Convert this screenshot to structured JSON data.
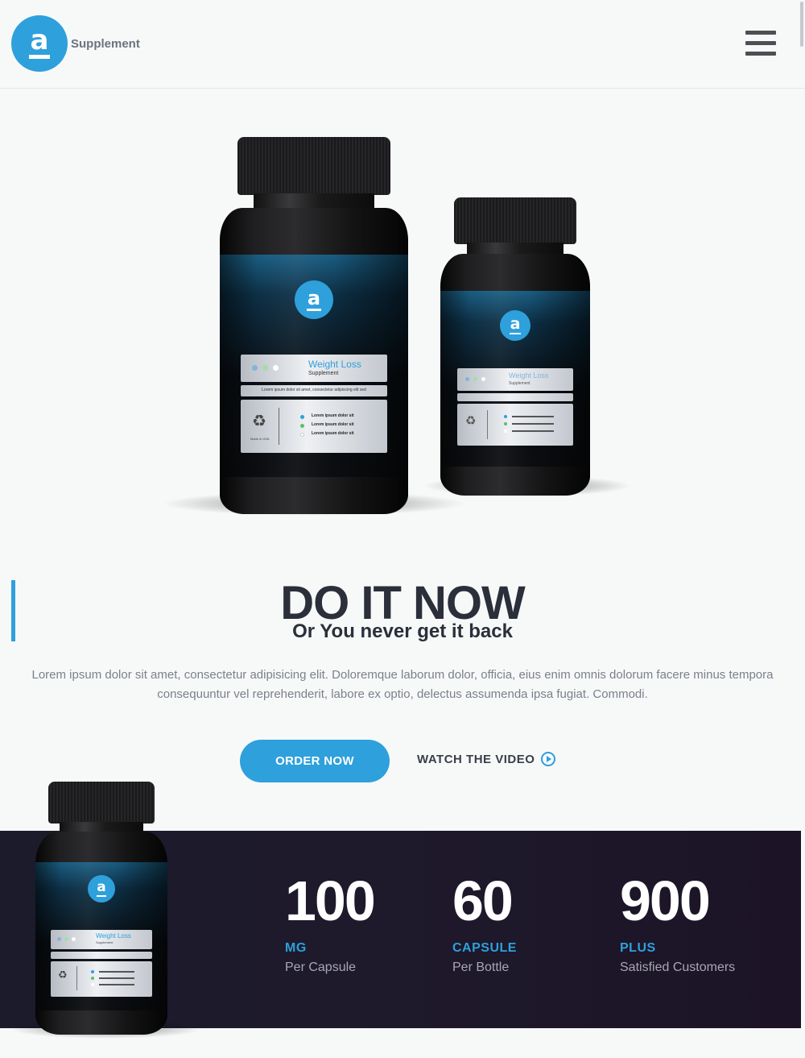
{
  "header": {
    "logo_letter": "a",
    "brand": "Supplement",
    "menu_icon": "hamburger-icon"
  },
  "product": {
    "label_title": "Weight Loss",
    "label_sub": "Supplement",
    "label_line": "Lorem ipsum dolor sit amet, consectetur adipiscing elit sed",
    "label_items": [
      "Lorem ipsum dolor sit",
      "Lorem ipsum dolor sit",
      "Lorem ipsum dolor sit"
    ],
    "made_in": "Made in USA"
  },
  "hero": {
    "title": "DO IT NOW",
    "subtitle": "Or You never get it back",
    "body": "Lorem ipsum dolor sit amet, consectetur adipisicing elit. Doloremque laborum dolor, officia, eius enim omnis dolorum facere minus tempora consequuntur vel reprehenderit, labore ex optio, delectus assumenda ipsa fugiat. Commodi.",
    "order_label": "ORDER NOW",
    "watch_label": "WATCH THE VIDEO"
  },
  "stats": [
    {
      "number": "100",
      "unit": "MG",
      "desc": "Per Capsule"
    },
    {
      "number": "60",
      "unit": "CAPSULE",
      "desc": "Per Bottle"
    },
    {
      "number": "900",
      "unit": "PLUS",
      "desc": "Satisfied Customers"
    }
  ],
  "colors": {
    "accent": "#2ea0dc",
    "dark_text": "#2b2f3a",
    "stats_bg": "#1c1828"
  }
}
